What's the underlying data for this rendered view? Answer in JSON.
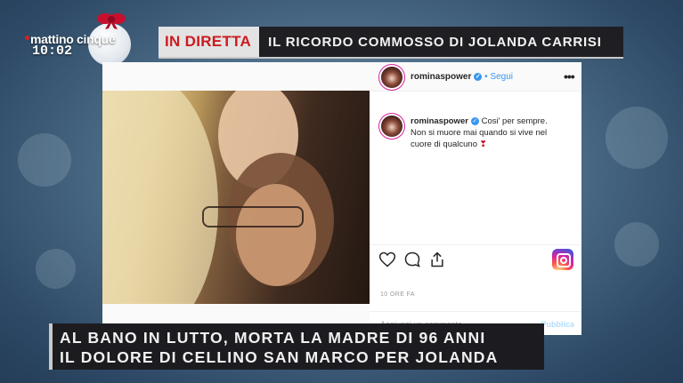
{
  "logo": {
    "name": "mattino cinque",
    "time": "10:02"
  },
  "banner": {
    "live_tag": "IN DIRETTA",
    "title": "IL RICORDO COMMOSSO DI JOLANDA CARRISI"
  },
  "post": {
    "username": "rominaspower",
    "follow_label": "Segui",
    "caption_lines": [
      "Cosi' per sempre.",
      "Non si muore mai quando si vive nel",
      "cuore di qualcuno"
    ],
    "time_ago": "10 ORE FA",
    "comment_placeholder": "Aggiungi un commento...",
    "publish_label": "Pubblica",
    "icons": [
      "heart-icon",
      "comment-icon",
      "share-icon",
      "instagram-icon",
      "more-options-icon",
      "verified-icon"
    ]
  },
  "lower_third": {
    "line1": "AL BANO IN LUTTO, MORTA LA MADRE DI 96 ANNI",
    "line2": "IL DOLORE DI CELLINO SAN MARCO PER JOLANDA"
  },
  "colors": {
    "live_red": "#cc1b20",
    "banner_bg": "#1f1f23",
    "ig_blue": "#3897f0"
  }
}
